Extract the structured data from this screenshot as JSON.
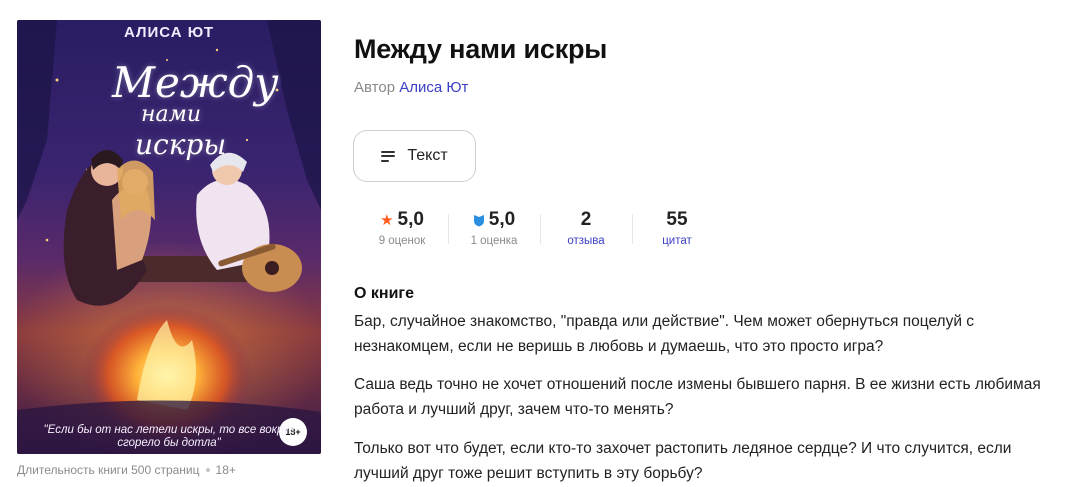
{
  "cover": {
    "author": "АЛИСА ЮТ",
    "title_line1": "Между",
    "title_line2": "нами",
    "title_line3": "искры",
    "quote": "\"Если бы от нас летели искры, то все вокруг сгорело бы дотла\"",
    "age_badge": "18+"
  },
  "meta": {
    "duration": "Длительность книги 500 страниц",
    "age": "18+"
  },
  "book": {
    "title": "Между нами искры",
    "author_prefix": "Автор",
    "author_name": "Алиса Ют"
  },
  "format": {
    "label": "Текст",
    "icon": "text-lines-icon"
  },
  "stats": [
    {
      "value": "5,0",
      "label": "9 оценок",
      "icon": "star-icon"
    },
    {
      "value": "5,0",
      "label": "1 оценка",
      "icon": "shield-icon"
    },
    {
      "value": "2",
      "label": "отзыва"
    },
    {
      "value": "55",
      "label": "цитат"
    }
  ],
  "about": {
    "heading": "О книге",
    "paragraphs": [
      "Бар, случайное знакомство, \"правда или действие\". Чем может обернуться поцелуй с незнакомцем, если не веришь в любовь и думаешь, что это просто игра?",
      "Саша ведь точно не хочет отношений после измены бывшего парня. В ее жизни есть любимая работа и лучший друг, зачем что-то менять?",
      "Только вот что будет, если кто-то захочет растопить ледяное сердце? И что случится, если лучший друг тоже решит вступить в эту борьбу?"
    ]
  },
  "colors": {
    "link": "#3b3ec4",
    "star": "#ff5a1f",
    "shield": "#2a8fe0"
  }
}
